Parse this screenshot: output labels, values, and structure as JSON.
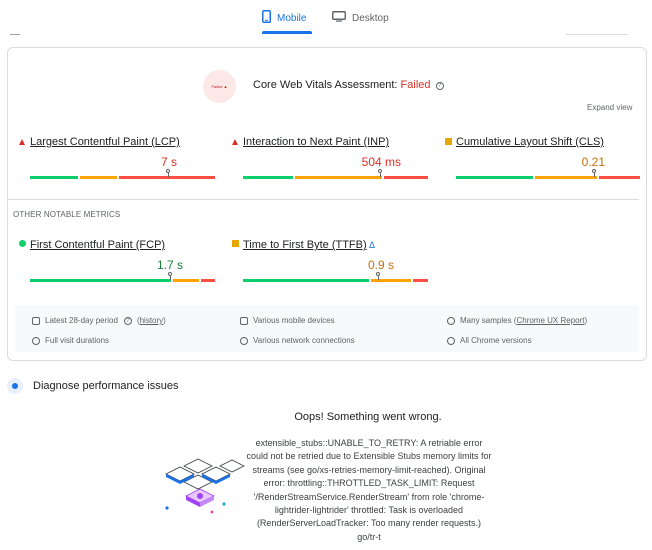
{
  "tabs": [
    {
      "label": "Mobile",
      "icon": "phone-icon",
      "active": true
    },
    {
      "label": "Desktop",
      "icon": "monitor-icon",
      "active": false
    }
  ],
  "assessment": {
    "prefix": "Core Web Vitals Assessment: ",
    "status": "Failed",
    "expand_label": "Expand view",
    "badge_text": "Failed ▲"
  },
  "core_metrics": [
    {
      "name": "Largest Contentful Paint (LCP)",
      "value": "7 s",
      "rating": "poor",
      "distribution": [
        0.38,
        0.2,
        0.42
      ]
    },
    {
      "name": "Interaction to Next Paint (INP)",
      "value": "504 ms",
      "rating": "poor",
      "distribution": [
        0.28,
        0.48,
        0.24
      ]
    },
    {
      "name": "Cumulative Layout Shift (CLS)",
      "value": "0.21",
      "rating": "needs-improvement",
      "distribution": [
        0.42,
        0.34,
        0.24
      ]
    }
  ],
  "other_label": "OTHER NOTABLE METRICS",
  "other_metrics": [
    {
      "name": "First Contentful Paint (FCP)",
      "value": "1.7 s",
      "rating": "good",
      "distribution": [
        0.78,
        0.14,
        0.08
      ]
    },
    {
      "name": "Time to First Byte (TTFB)",
      "value": "0.9 s",
      "rating": "needs-improvement",
      "distribution": [
        0.7,
        0.22,
        0.08
      ]
    }
  ],
  "beta_icon": "Δ",
  "info": {
    "period": "Latest 28-day period",
    "history_link": "history",
    "devices": "Various mobile devices",
    "samples_prefix": "Many samples (",
    "samples_link": "Chrome UX Report",
    "samples_suffix": ")",
    "durations": "Full visit durations",
    "connections": "Various network connections",
    "versions": "All Chrome versions"
  },
  "diagnose": {
    "title": "Diagnose performance issues"
  },
  "error": {
    "title": "Oops! Something went wrong.",
    "message": "extensible_stubs::UNABLE_TO_RETRY: A retriable error could not be retried due to Extensible Stubs memory limits for streams (see go/xs-retries-memory-limit-reached). Original error: throttling::THROTTLED_TASK_LIMIT: Request '/RenderStreamService.RenderStream' from role 'chrome-lightrider-lightrider' throttled: Task is overloaded (RenderServerLoadTracker: Too many render requests.) go/tr-t"
  },
  "colors": {
    "accent": "#1a73e8",
    "fail": "#d93025",
    "good": "#0cce6b",
    "average": "#ffa400",
    "poor": "#ff4e42"
  }
}
